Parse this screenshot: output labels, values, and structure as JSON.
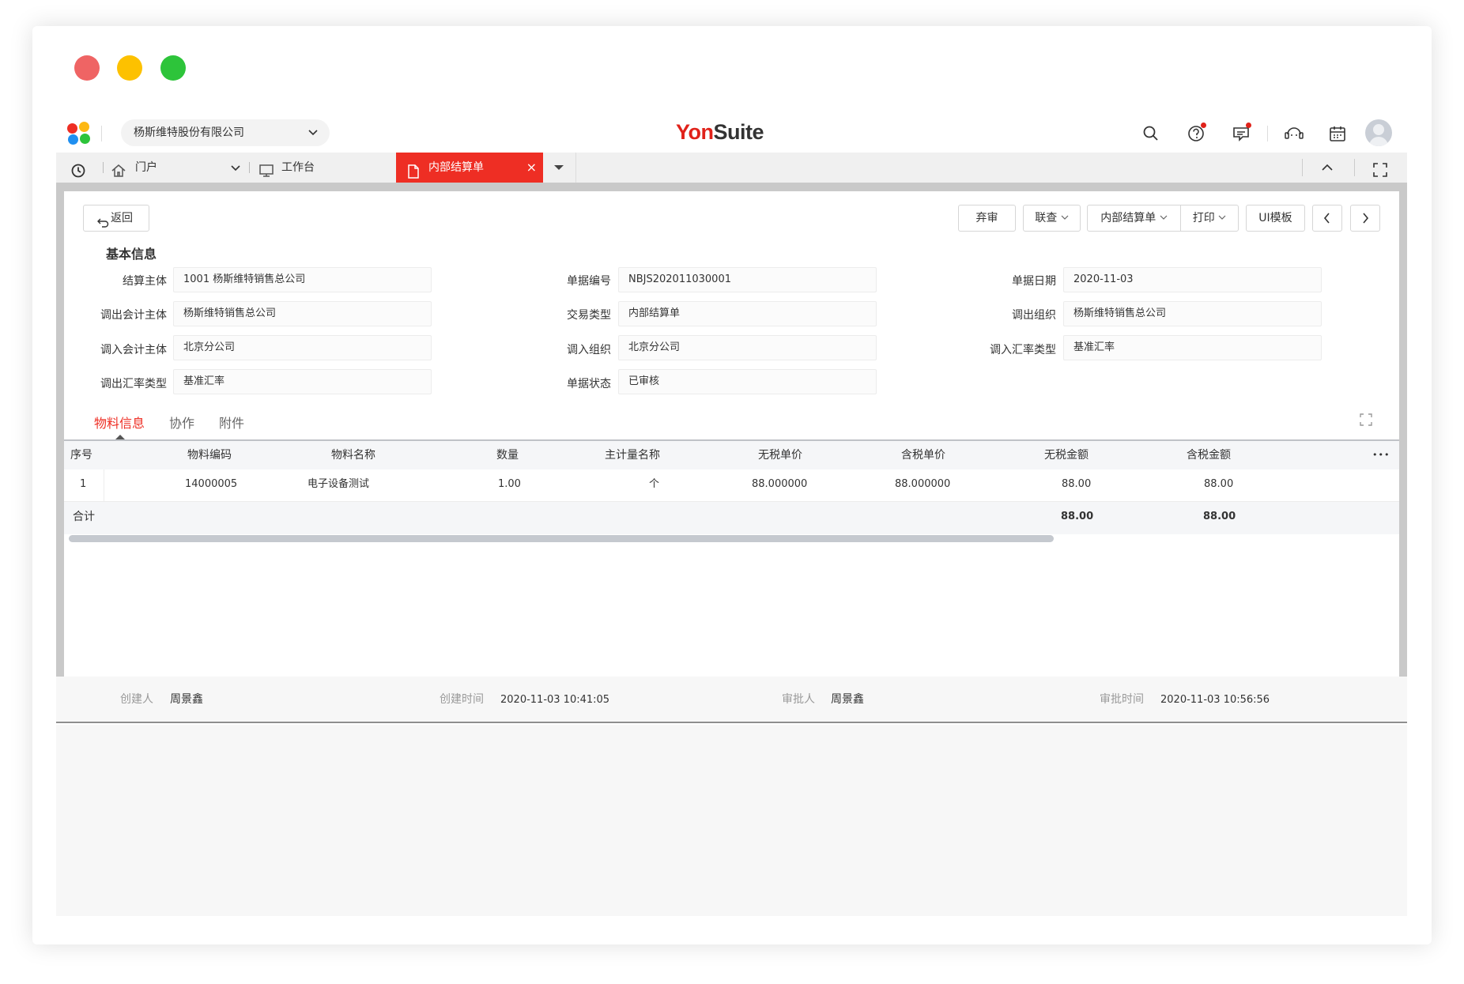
{
  "org_selector": {
    "value": "杨斯维特股份有限公司"
  },
  "brand": {
    "part1": "Yon",
    "part2": "Suite"
  },
  "tabs": {
    "home": "门户",
    "workbench": "工作台",
    "active": "内部结算单",
    "close": "×"
  },
  "toolbar": {
    "back": "返回",
    "abandon_review": "弃审",
    "linked_query": "联查",
    "doc_menu": "内部结算单",
    "print": "打印",
    "ui_template": "UI模板"
  },
  "basic_info": {
    "title": "基本信息",
    "fields": [
      {
        "label": "结算主体",
        "value": "1001 杨斯维特销售总公司"
      },
      {
        "label": "单据编号",
        "value": "NBJS202011030001"
      },
      {
        "label": "单据日期",
        "value": "2020-11-03"
      },
      {
        "label": "调出会计主体",
        "value": "杨斯维特销售总公司"
      },
      {
        "label": "交易类型",
        "value": "内部结算单"
      },
      {
        "label": "调出组织",
        "value": "杨斯维特销售总公司"
      },
      {
        "label": "调入会计主体",
        "value": "北京分公司"
      },
      {
        "label": "调入组织",
        "value": "北京分公司"
      },
      {
        "label": "调入汇率类型",
        "value": "基准汇率"
      },
      {
        "label": "调出汇率类型",
        "value": "基准汇率"
      },
      {
        "label": "单据状态",
        "value": "已审核"
      }
    ]
  },
  "sub_tabs": [
    "物料信息",
    "协作",
    "附件"
  ],
  "table": {
    "columns": [
      "序号",
      "物料编码",
      "物料名称",
      "数量",
      "主计量名称",
      "无税单价",
      "含税单价",
      "无税金额",
      "含税金额"
    ],
    "more": "•••",
    "rows": [
      [
        "1",
        "14000005",
        "电子设备测试",
        "1.00",
        "个",
        "88.000000",
        "88.000000",
        "88.00",
        "88.00"
      ]
    ],
    "summary": {
      "label": "合计",
      "untaxed_total": "88.00",
      "taxed_total": "88.00"
    }
  },
  "footer": {
    "creator_label": "创建人",
    "creator": "周景鑫",
    "created_time_label": "创建时间",
    "created_time": "2020-11-03 10:41:05",
    "approver_label": "审批人",
    "approver": "周景鑫",
    "approved_time_label": "审批时间",
    "approved_time": "2020-11-03 10:56:56"
  },
  "colors": {
    "accent": "#ee2e24",
    "window_red": "#ef6464",
    "window_yellow": "#fdc100",
    "window_green": "#2dc43a"
  }
}
